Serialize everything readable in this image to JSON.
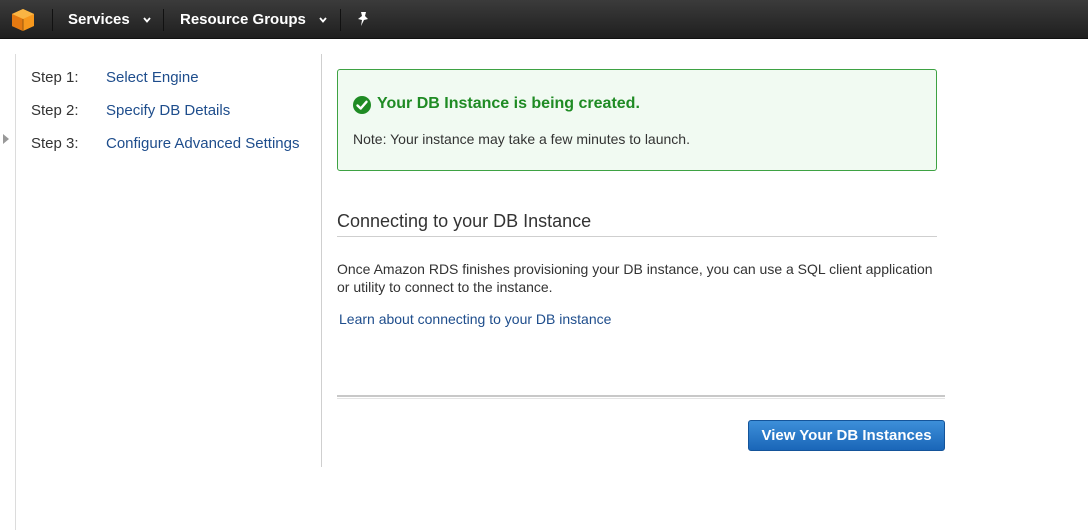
{
  "nav": {
    "services_label": "Services",
    "resource_groups_label": "Resource Groups",
    "logo_icon": "aws-cube-icon",
    "pin_icon": "pin-icon",
    "caret_icon": "chevron-down-icon"
  },
  "steps": [
    {
      "num": "Step 1:",
      "label": "Select Engine"
    },
    {
      "num": "Step 2:",
      "label": "Specify DB Details"
    },
    {
      "num": "Step 3:",
      "label": "Configure Advanced Settings"
    }
  ],
  "success": {
    "icon": "check-circle-icon",
    "title": "Your DB Instance is being created.",
    "note": "Note: Your instance may take a few minutes to launch."
  },
  "connecting": {
    "title": "Connecting to your DB Instance",
    "body": "Once Amazon RDS finishes provisioning your DB instance, you can use a SQL client application or utility to connect to the instance.",
    "link": "Learn about connecting to your DB instance"
  },
  "actions": {
    "view_instances_label": "View Your DB Instances"
  },
  "colors": {
    "topbar": "#232323",
    "link": "#1e4d8c",
    "success_green": "#1f8b24",
    "primary_button": "#1a66b8"
  }
}
